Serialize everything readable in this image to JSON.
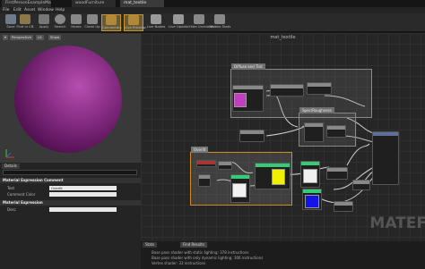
{
  "tabs": [
    "FirstPersonExampleMap",
    "woodFurniture",
    "mat_textile"
  ],
  "menu": [
    "File",
    "Edit",
    "Asset",
    "Window",
    "Help"
  ],
  "toolbar": [
    {
      "label": "Save",
      "icon": "save-icon",
      "color": "#6e7b8a"
    },
    {
      "label": "Find in CB",
      "icon": "find-icon",
      "color": "#8a7a4a"
    },
    {
      "label": "Apply",
      "icon": "apply-icon",
      "color": "#777777"
    },
    {
      "label": "Search",
      "icon": "search-icon",
      "color": "#888888"
    },
    {
      "label": "Home",
      "icon": "home-icon",
      "color": "#888888"
    },
    {
      "label": "Clean Up",
      "icon": "cleanup-icon",
      "color": "#888888"
    },
    {
      "label": "Connectors",
      "icon": "connectors-icon",
      "color": "#b08a3a"
    },
    {
      "label": "Live Preview",
      "icon": "live-preview-icon",
      "color": "#b08a3a"
    },
    {
      "label": "Live Nodes",
      "icon": "live-nodes-icon",
      "color": "#999999"
    },
    {
      "label": "Live Update",
      "icon": "live-update-icon",
      "color": "#999999"
    },
    {
      "label": "Hide Unrelated",
      "icon": "hide-unrelated-icon",
      "color": "#888888"
    },
    {
      "label": "Mobile Stats",
      "icon": "mobile-stats-icon",
      "color": "#888888"
    }
  ],
  "viewport": {
    "mode": "Perspective",
    "lit": "Lit",
    "show": "Show"
  },
  "details": {
    "tab": "Details",
    "sections": {
      "comment": "Material Expression Comment",
      "expression": "Material Expression"
    },
    "rows": {
      "text_label": "Text",
      "text_value": "Overlit",
      "color_label": "Comment Color",
      "desc_label": "Desc"
    }
  },
  "graph": {
    "title": "mat_textile",
    "comments": [
      "Diffuse and Tint",
      "Overlit",
      "Spec/Roughness"
    ],
    "watermark": "MATEF"
  },
  "results": {
    "tabs": [
      "Stats",
      "Find Results"
    ],
    "lines": [
      "Base pass shader with static lighting: 378 instructions",
      "Base pass shader with only dynamic lighting: 306 instructions",
      "Vertex shader: 33 instructions"
    ]
  }
}
